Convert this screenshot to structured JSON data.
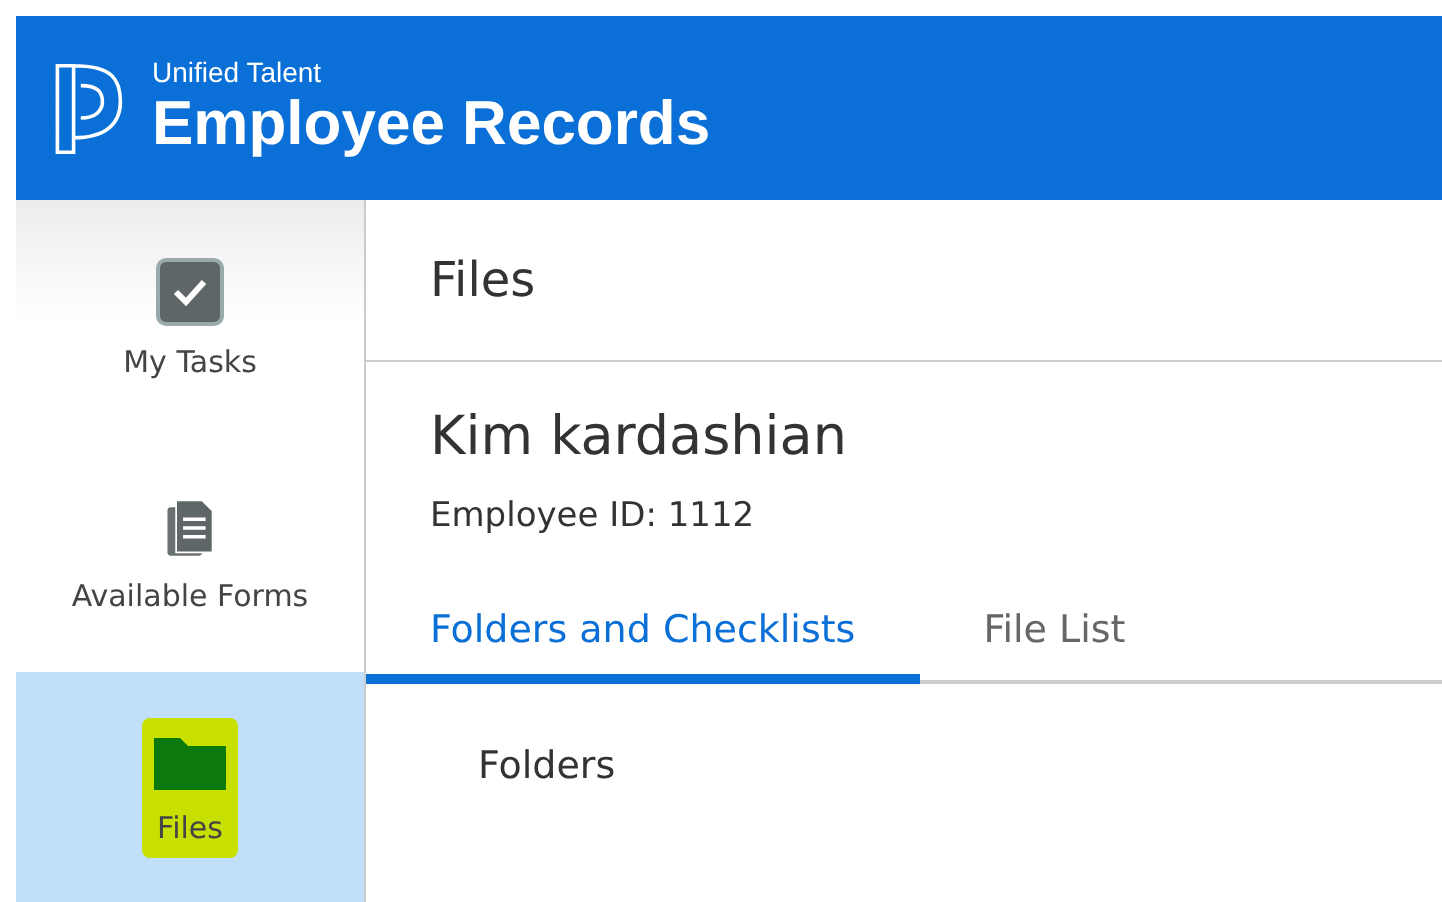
{
  "header": {
    "subtitle": "Unified Talent",
    "title": "Employee Records"
  },
  "sidebar": {
    "items": [
      {
        "label": "My Tasks",
        "selected": false,
        "highlighted": false
      },
      {
        "label": "Available Forms",
        "selected": false,
        "highlighted": false
      },
      {
        "label": "Files",
        "selected": true,
        "highlighted": true
      }
    ]
  },
  "page": {
    "title": "Files",
    "employee_name": "Kim kardashian",
    "employee_id": "Employee ID: 1112"
  },
  "tabs": [
    {
      "label": "Folders and Checklists",
      "selected": true
    },
    {
      "label": "File List",
      "selected": false
    }
  ],
  "section": {
    "heading": "Folders"
  }
}
